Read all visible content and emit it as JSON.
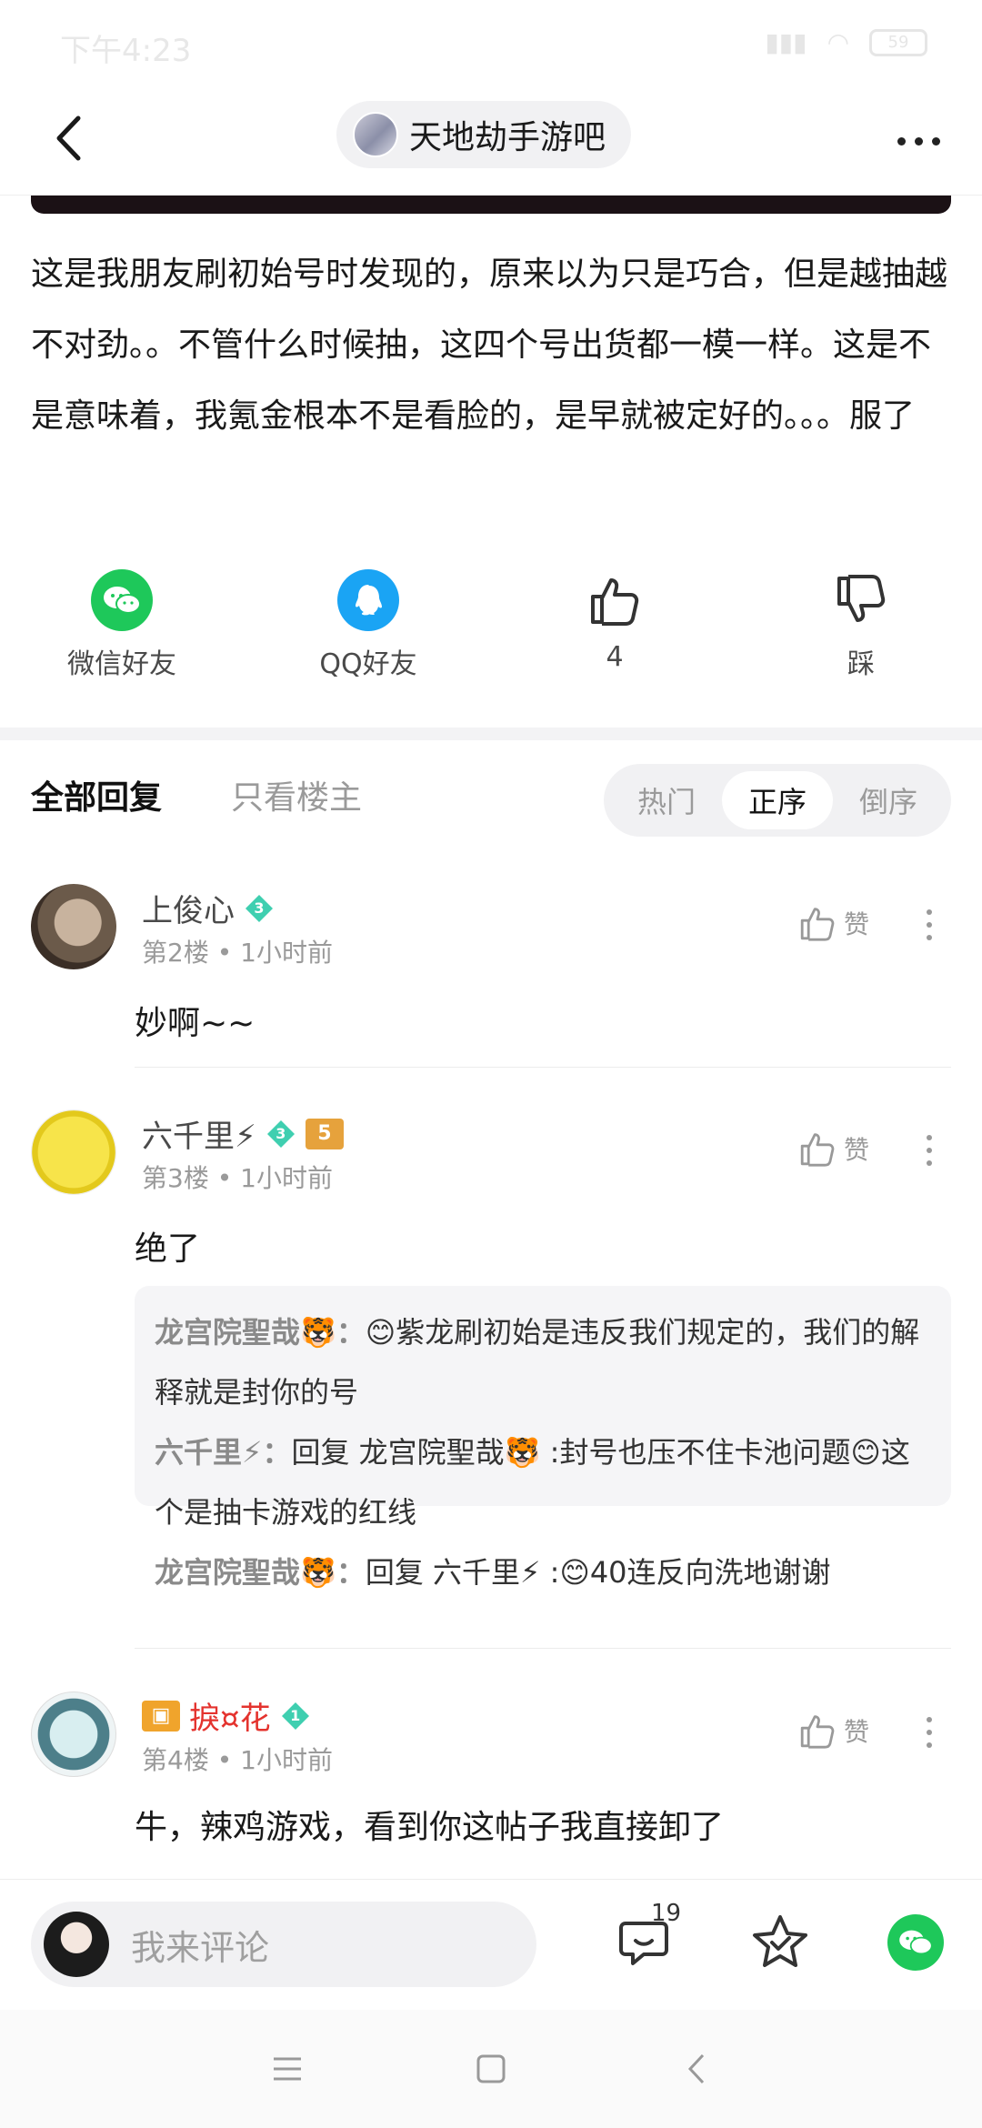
{
  "status_bar": {
    "time": "下午4:23",
    "battery": "59"
  },
  "nav": {
    "forum_name": "天地劫手游吧"
  },
  "post": {
    "body": "这是我朋友刷初始号时发现的，原来以为只是巧合，但是越抽越不对劲。。不管什么时候抽，这四个号出货都一模一样。这是不是意味着，我氪金根本不是看脸的，是早就被定好的。。。服了"
  },
  "actions": {
    "wechat": "微信好友",
    "qq": "QQ好友",
    "like_count": "4",
    "dislike": "踩"
  },
  "reply_tabs": {
    "all": "全部回复",
    "owner_only": "只看楼主",
    "sort": [
      "热门",
      "正序",
      "倒序"
    ],
    "active_sort": "正序"
  },
  "comments": [
    {
      "name": "上俊心",
      "level": "3",
      "floor": "第2楼",
      "time": "1小时前",
      "text": "妙啊~~",
      "like_label": "赞"
    },
    {
      "name": "六千里⚡",
      "level": "3",
      "rank": "5",
      "floor": "第3楼",
      "time": "1小时前",
      "text": "绝了",
      "like_label": "赞",
      "sub_replies": [
        {
          "who": "龙宫院聖哉🐯：",
          "text": "😊紫龙刷初始是违反我们规定的，我们的解释就是封你的号"
        },
        {
          "who": "六千里⚡：",
          "text": "回复 龙宫院聖哉🐯 :封号也压不住卡池问题😊这个是抽卡游戏的红线"
        },
        {
          "who": "龙宫院聖哉🐯：",
          "text": "回复 六千里⚡ :😊40连反向洗地谢谢"
        }
      ]
    },
    {
      "name": "捩¤花",
      "level": "1",
      "floor": "第4楼",
      "time": "1小时前",
      "text": "牛，辣鸡游戏，看到你这帖子我直接卸了",
      "like_label": "赞"
    }
  ],
  "bottom_bar": {
    "placeholder": "我来评论",
    "reply_count": "19"
  },
  "colors": {
    "wechat_green": "#1ec85a",
    "qq_blue": "#1aa4f4",
    "gem_teal": "#3fcfb0",
    "vip_red": "#e4332e"
  }
}
